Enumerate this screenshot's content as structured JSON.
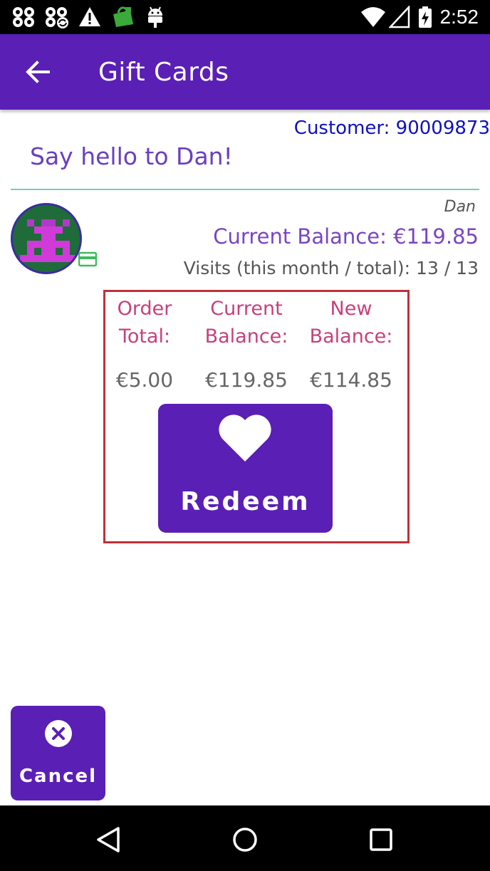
{
  "status_bar": {
    "time": "2:52",
    "icons": [
      "clover-icon",
      "clover-sync-icon",
      "warning-icon",
      "shopping-bag-icon",
      "android-icon",
      "wifi-icon",
      "cell-signal-icon",
      "battery-charging-icon"
    ]
  },
  "app_bar": {
    "title": "Gift Cards",
    "back_icon": "arrow-left-icon"
  },
  "customer": {
    "label": "Customer: 90009873",
    "greeting": "Say hello to Dan!",
    "name": "Dan",
    "balance": "Current Balance: €119.85",
    "visits": "Visits (this month / total): 13 / 13"
  },
  "redeem_panel": {
    "columns": [
      {
        "header_line1": "Order",
        "header_line2": "Total:",
        "value": "€5.00"
      },
      {
        "header_line1": "Current",
        "header_line2": "Balance:",
        "value": "€119.85"
      },
      {
        "header_line1": "New",
        "header_line2": "Balance:",
        "value": "€114.85"
      }
    ],
    "redeem_label": "Redeem",
    "redeem_icon": "heart-icon"
  },
  "cancel": {
    "label": "Cancel",
    "icon": "close-circle-icon"
  },
  "nav_bar": {
    "buttons": [
      "back-triangle-icon",
      "home-circle-icon",
      "recents-square-icon"
    ]
  },
  "colors": {
    "primary": "#5a1fb5",
    "customer_id": "#1010c0",
    "accent_text": "#7a45c2",
    "header_pink": "#c8407a",
    "panel_border": "#c0303a",
    "divider": "#7dc9b8"
  }
}
